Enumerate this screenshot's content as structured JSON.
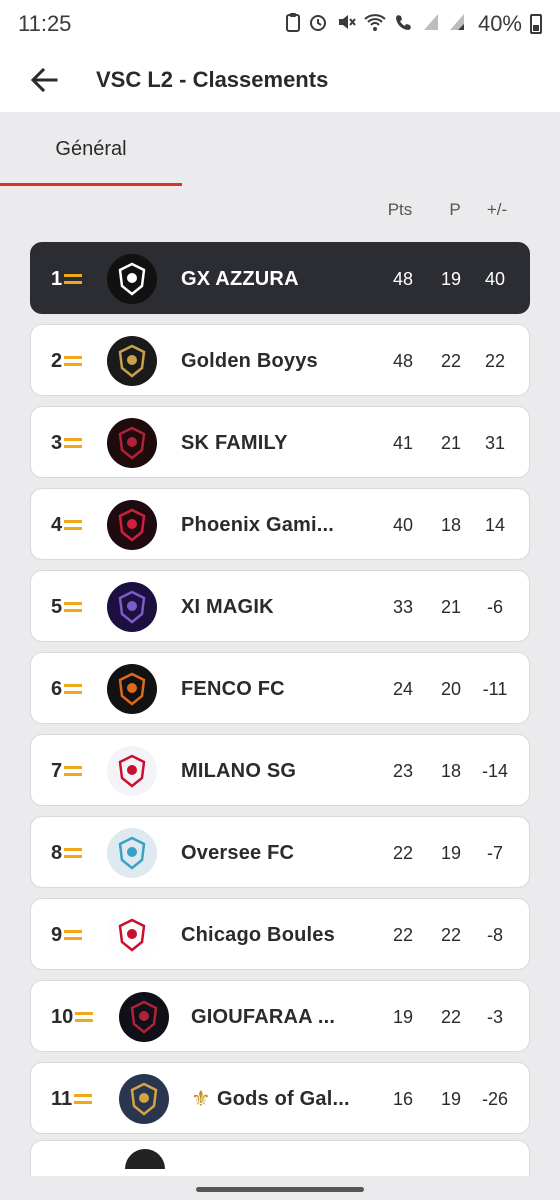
{
  "status": {
    "time": "11:25",
    "battery": "40%",
    "icons": [
      "clipboard-icon",
      "alarm-icon",
      "mute-icon",
      "wifi-icon",
      "wifi-call-icon",
      "signal-icon",
      "signal-icon-2",
      "battery-icon"
    ]
  },
  "appbar": {
    "title": "VSC L2 - Classements",
    "back_icon": "arrow-left-icon"
  },
  "tabs": [
    {
      "label": "Général",
      "active": true
    }
  ],
  "columns": {
    "pts": "Pts",
    "played": "P",
    "diff": "+/-"
  },
  "colors": {
    "accent_red": "#d9342b",
    "rank_equal": "#f0a818",
    "active_row": "#2b2d33"
  },
  "standings": [
    {
      "rank": "1",
      "name": "GX AZZURA",
      "pts": "48",
      "played": "19",
      "diff": "40",
      "logo": "gx-azzura-logo",
      "active": true
    },
    {
      "rank": "2",
      "name": "Golden Boyys",
      "pts": "48",
      "played": "22",
      "diff": "22",
      "logo": "golden-boyys-logo"
    },
    {
      "rank": "3",
      "name": "SK FAMILY",
      "pts": "41",
      "played": "21",
      "diff": "31",
      "logo": "sk-family-logo"
    },
    {
      "rank": "4",
      "name": "Phoenix Gami...",
      "pts": "40",
      "played": "18",
      "diff": "14",
      "logo": "phoenix-logo"
    },
    {
      "rank": "5",
      "name": "XI MAGIK",
      "pts": "33",
      "played": "21",
      "diff": "-6",
      "logo": "xi-magik-logo"
    },
    {
      "rank": "6",
      "name": "FENCO FC",
      "pts": "24",
      "played": "20",
      "diff": "-11",
      "logo": "fenco-logo"
    },
    {
      "rank": "7",
      "name": "MILANO SG",
      "pts": "23",
      "played": "18",
      "diff": "-14",
      "logo": "milano-logo"
    },
    {
      "rank": "8",
      "name": "Oversee FC",
      "pts": "22",
      "played": "19",
      "diff": "-7",
      "logo": "oversee-logo"
    },
    {
      "rank": "9",
      "name": "Chicago Boules",
      "pts": "22",
      "played": "22",
      "diff": "-8",
      "logo": "chicago-logo"
    },
    {
      "rank": "10",
      "name": "GIOUFARAA ...",
      "pts": "19",
      "played": "22",
      "diff": "-3",
      "logo": "gioufaraa-logo"
    },
    {
      "rank": "11",
      "name": "Gods of Gal...",
      "pts": "16",
      "played": "19",
      "diff": "-26",
      "logo": "gods-logo",
      "prefix_icon": "fleur-de-lis-icon"
    }
  ]
}
